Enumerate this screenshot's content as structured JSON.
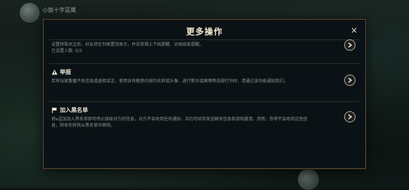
{
  "background": {
    "player_name": "小狼十字蓝鹰"
  },
  "dialog": {
    "title": "更多操作",
    "close_glyph": "×",
    "sections": [
      {
        "title": "",
        "description": "设置特殊关注后，好友将在列表置顶显示，并且获得上下线提醒、对局结束提醒。",
        "extra": "已设置人数: 0/3"
      },
      {
        "title": "举报",
        "icon": "warning-icon",
        "description": "若有玩家散播不良信息或虚假谣言、使用含有敏感内容的名称或头像、进行欺诈或赌博等违规行为时，请通过该功能通知我们。"
      },
      {
        "title": "加入黑名单",
        "icon": "blacklist-icon",
        "description": "将e逗加加入黑名单即可停止接收对方的信息，对方不会收到任何通知，且仍可给你发送聊天信息和游戏邀请。然而，你将不会收到这些信息，除非你将其从黑名单中移除。"
      }
    ]
  },
  "colors": {
    "accent_gold": "#5b4e33",
    "title_text": "#efe6cf",
    "body_text": "#8c9592"
  }
}
